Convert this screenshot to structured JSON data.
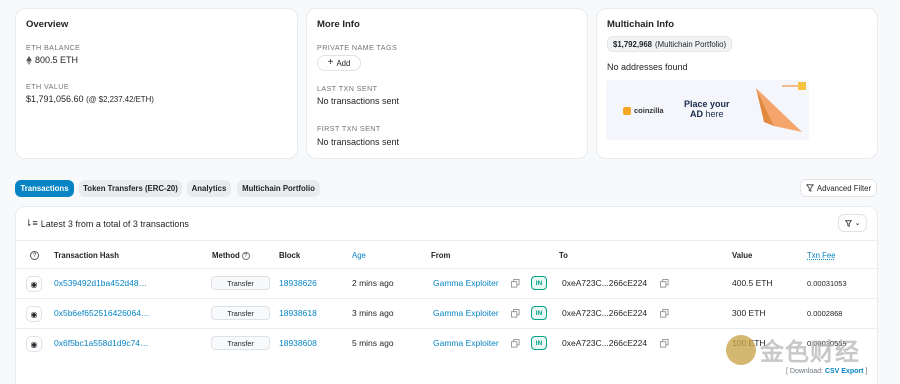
{
  "overview": {
    "title": "Overview",
    "eth_balance_label": "ETH BALANCE",
    "eth_balance_value": "800.5 ETH",
    "eth_value_label": "ETH VALUE",
    "eth_value_amount": "$1,791,056.60",
    "eth_value_rate": "(@ $2,237.42/ETH)"
  },
  "more_info": {
    "title": "More Info",
    "private_tags_label": "PRIVATE NAME TAGS",
    "add_button": "Add",
    "last_txn_label": "LAST TXN SENT",
    "last_txn_value": "No transactions sent",
    "first_txn_label": "FIRST TXN SENT",
    "first_txn_value": "No transactions sent"
  },
  "multichain": {
    "title": "Multichain Info",
    "portfolio_amount": "$1,792,968",
    "portfolio_suffix": "(Multichain Portfolio)",
    "no_addresses": "No addresses found",
    "ad_brand": "coinzilla",
    "ad_line1": "Place your",
    "ad_line2_bold": "AD",
    "ad_line2_rest": "here"
  },
  "tabs": [
    {
      "label": "Transactions",
      "active": true
    },
    {
      "label": "Token Transfers (ERC-20)",
      "active": false
    },
    {
      "label": "Analytics",
      "active": false
    },
    {
      "label": "Multichain Portfolio",
      "active": false
    }
  ],
  "advanced_filter": "Advanced Filter",
  "table": {
    "summary": "Latest 3 from a total of 3 transactions",
    "headers": {
      "hash": "Transaction Hash",
      "method": "Method",
      "block": "Block",
      "age": "Age",
      "from": "From",
      "to": "To",
      "value": "Value",
      "fee": "Txn Fee"
    },
    "rows": [
      {
        "hash": "0x539492d1ba452d48…",
        "method": "Transfer",
        "block": "18938626",
        "age": "2 mins ago",
        "from": "Gamma Exploiter",
        "direction": "IN",
        "to": "0xeA723C...266cE224",
        "value": "400.5 ETH",
        "fee": "0.00031053"
      },
      {
        "hash": "0x5b6ef652516426064…",
        "method": "Transfer",
        "block": "18938618",
        "age": "3 mins ago",
        "from": "Gamma Exploiter",
        "direction": "IN",
        "to": "0xeA723C...266cE224",
        "value": "300 ETH",
        "fee": "0.0002868"
      },
      {
        "hash": "0x6f5bc1a558d1d9c74…",
        "method": "Transfer",
        "block": "18938608",
        "age": "5 mins ago",
        "from": "Gamma Exploiter",
        "direction": "IN",
        "to": "0xeA723C...266cE224",
        "value": "100 ETH",
        "fee": "0.00030559"
      }
    ],
    "download_label": "[ Download:",
    "download_link": "CSV Export",
    "download_end": "]"
  },
  "watermark": "金色财经"
}
